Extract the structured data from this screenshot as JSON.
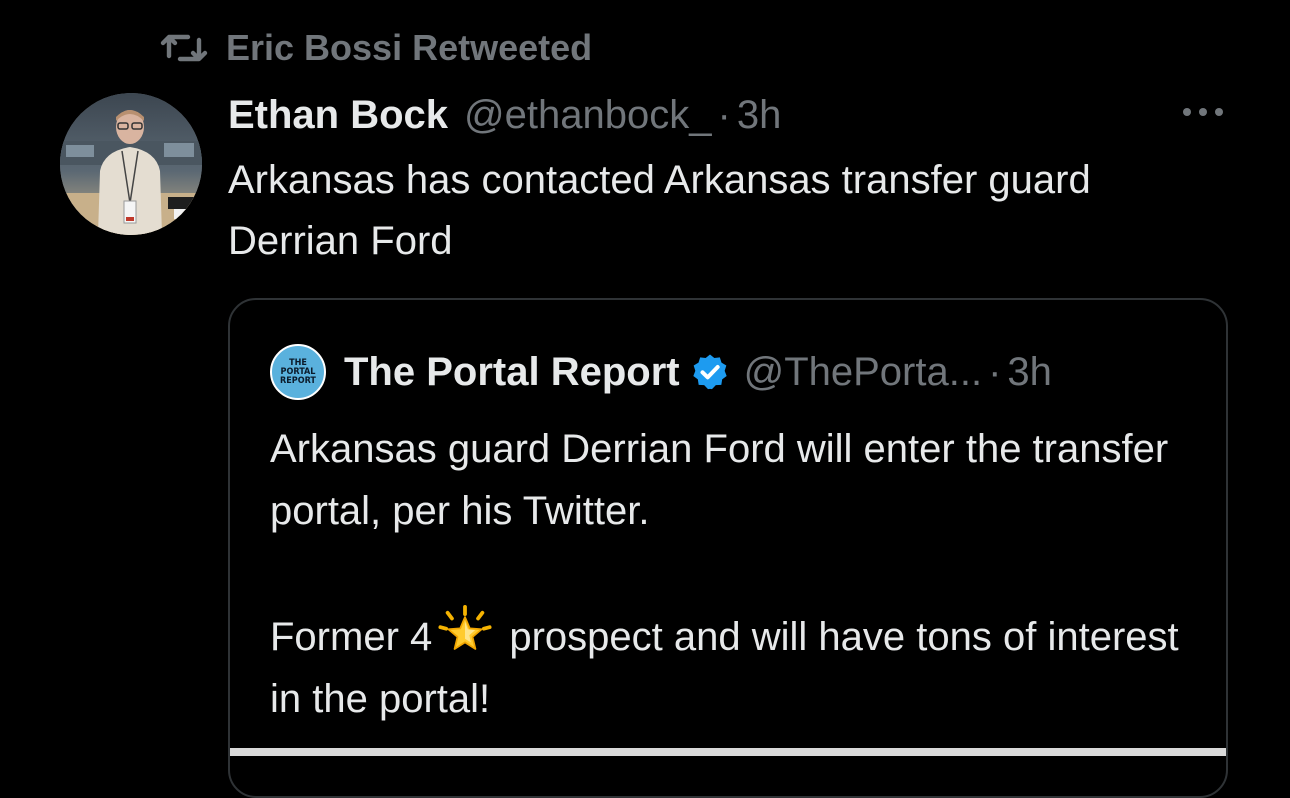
{
  "retweet_banner": {
    "icon": "retweet-icon",
    "text": "Eric Bossi Retweeted"
  },
  "tweet": {
    "avatar_icon": "user-avatar",
    "display_name": "Ethan Bock",
    "handle": "@ethanbock_",
    "separator": "·",
    "time": "3h",
    "more_icon": "more-horizontal-icon",
    "text": "Arkansas has contacted Arkansas transfer guard Derrian Ford"
  },
  "quote": {
    "avatar_lines": [
      "THE",
      "PORTAL",
      "REPORT"
    ],
    "display_name": "The Portal Report",
    "verified_icon": "verified-badge-icon",
    "handle": "@ThePorta...",
    "separator": "·",
    "time": "3h",
    "paragraph1": "Arkansas guard Derrian Ford will enter the transfer portal, per his Twitter.",
    "paragraph2_before": "Former 4",
    "paragraph2_emoji": "glowing-star-emoji",
    "paragraph2_after": " prospect and will have tons of interest in the portal!"
  },
  "colors": {
    "background": "#000000",
    "primary_text": "#e7e9ea",
    "secondary_text": "#71767b",
    "border": "#2f3336",
    "verified_blue": "#1d9bf0"
  }
}
